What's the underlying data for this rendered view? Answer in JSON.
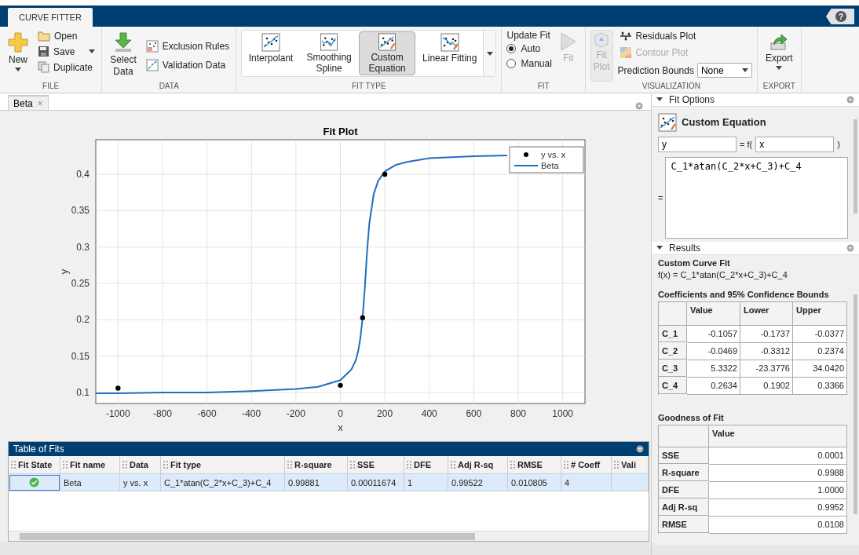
{
  "app_tab": "CURVE FITTER",
  "help_button": "?",
  "ribbon": {
    "file": {
      "label": "FILE",
      "new": "New",
      "open": "Open",
      "save": "Save",
      "duplicate": "Duplicate"
    },
    "data": {
      "label": "DATA",
      "select_data": "Select\nData",
      "exclusion_rules": "Exclusion Rules",
      "validation_data": "Validation Data"
    },
    "fit_type": {
      "label": "FIT TYPE",
      "options": [
        {
          "label": "Interpolant",
          "selected": false
        },
        {
          "label": "Smoothing\nSpline",
          "selected": false
        },
        {
          "label": "Custom\nEquation",
          "selected": true
        },
        {
          "label": "Linear Fitting",
          "selected": false
        }
      ]
    },
    "fit": {
      "label": "FIT",
      "title": "Update Fit",
      "modes": [
        {
          "label": "Auto",
          "selected": true
        },
        {
          "label": "Manual",
          "selected": false
        }
      ],
      "fit_button": {
        "label": "Fit",
        "disabled": true
      }
    },
    "visualization": {
      "label": "VISUALIZATION",
      "fit_plot": {
        "label": "Fit\nPlot",
        "disabled": true
      },
      "residuals_plot": {
        "label": "Residuals Plot",
        "disabled": false
      },
      "contour_plot": {
        "label": "Contour Plot",
        "disabled": true
      },
      "prediction_bounds": {
        "label": "Prediction Bounds",
        "value": "None"
      }
    },
    "export": {
      "label": "EXPORT",
      "button": "Export"
    }
  },
  "document_tabs": [
    {
      "label": "Beta",
      "selected": true,
      "close": "×"
    }
  ],
  "fit_plot": {
    "chart_data": {
      "type": "line",
      "grid": true,
      "legend": true,
      "title": "Fit Plot",
      "xlabel": "x",
      "ylabel": "y",
      "xlim": [
        -1100,
        1100
      ],
      "ylim": [
        0.085,
        0.4475
      ],
      "xticks": [
        -1000,
        -800,
        -600,
        -400,
        -200,
        0,
        200,
        400,
        600,
        800,
        1000
      ],
      "yticks": [
        0.1,
        0.15,
        0.2,
        0.25,
        0.3,
        0.35,
        0.4
      ],
      "x": [
        -1100,
        -1000,
        -800,
        -600,
        -400,
        -200,
        -100,
        0,
        50,
        70,
        80,
        90,
        100,
        110,
        120,
        130,
        150,
        170,
        200,
        250,
        300,
        400,
        600,
        750
      ],
      "series": [
        {
          "name": "y vs. x",
          "type": "scatter",
          "color": "#000000",
          "values": [
            null,
            0.106,
            null,
            null,
            null,
            null,
            null,
            0.11,
            null,
            null,
            null,
            null,
            0.203,
            null,
            null,
            null,
            null,
            null,
            0.4,
            null,
            null,
            null,
            null,
            null
          ]
        },
        {
          "name": "Beta",
          "color": "#1f6fc0",
          "values": [
            0.099,
            0.099,
            0.1,
            0.1,
            0.102,
            0.105,
            0.108,
            0.117,
            0.132,
            0.145,
            0.157,
            0.175,
            0.203,
            0.245,
            0.294,
            0.332,
            0.373,
            0.391,
            0.404,
            0.413,
            0.417,
            0.422,
            0.425,
            0.426
          ]
        }
      ]
    }
  },
  "table_of_fits": {
    "title": "Table of Fits",
    "columns": [
      "Fit State",
      "Fit name",
      "Data",
      "Fit type",
      "R-square",
      "SSE",
      "DFE",
      "Adj R-sq",
      "RMSE",
      "# Coeff",
      "Vali"
    ],
    "rows": [
      {
        "fit_succeeded": true,
        "selected": true,
        "cells": [
          "",
          "Beta",
          "y vs. x",
          "C_1*atan(C_2*x+C_3)+C_4",
          "0.99881",
          "0.00011674",
          "1",
          "0.99522",
          "0.010805",
          "4"
        ]
      }
    ]
  },
  "fit_options": {
    "title": "Fit Options",
    "equation_title": "Custom Equation",
    "output_variable": "y",
    "function_label": "= f(",
    "input_variable": "x",
    "close_paren": ")",
    "equals": "=",
    "equation": "C_1*atan(C_2*x+C_3)+C_4"
  },
  "results": {
    "title": "Results",
    "fit_heading": "Custom Curve Fit",
    "formula": "f(x) = C_1*atan(C_2*x+C_3)+C_4",
    "coefficients": {
      "title": "Coefficients and 95% Confidence Bounds",
      "columns": [
        "Value",
        "Lower",
        "Upper"
      ],
      "rows": [
        {
          "name": "C_1",
          "cells": [
            "-0.1057",
            "-0.1737",
            "-0.0377"
          ]
        },
        {
          "name": "C_2",
          "cells": [
            "-0.0469",
            "-0.3312",
            "0.2374"
          ]
        },
        {
          "name": "C_3",
          "cells": [
            "5.3322",
            "-23.3776",
            "34.0420"
          ]
        },
        {
          "name": "C_4",
          "cells": [
            "0.2634",
            "0.1902",
            "0.3366"
          ]
        }
      ]
    },
    "goodness": {
      "title": "Goodness of Fit",
      "columns": [
        "Value"
      ],
      "rows": [
        {
          "name": "SSE",
          "value": "0.0001"
        },
        {
          "name": "R-square",
          "value": "0.9988"
        },
        {
          "name": "DFE",
          "value": "1.0000"
        },
        {
          "name": "Adj R-sq",
          "value": "0.9952"
        },
        {
          "name": "RMSE",
          "value": "0.0108"
        }
      ]
    }
  }
}
